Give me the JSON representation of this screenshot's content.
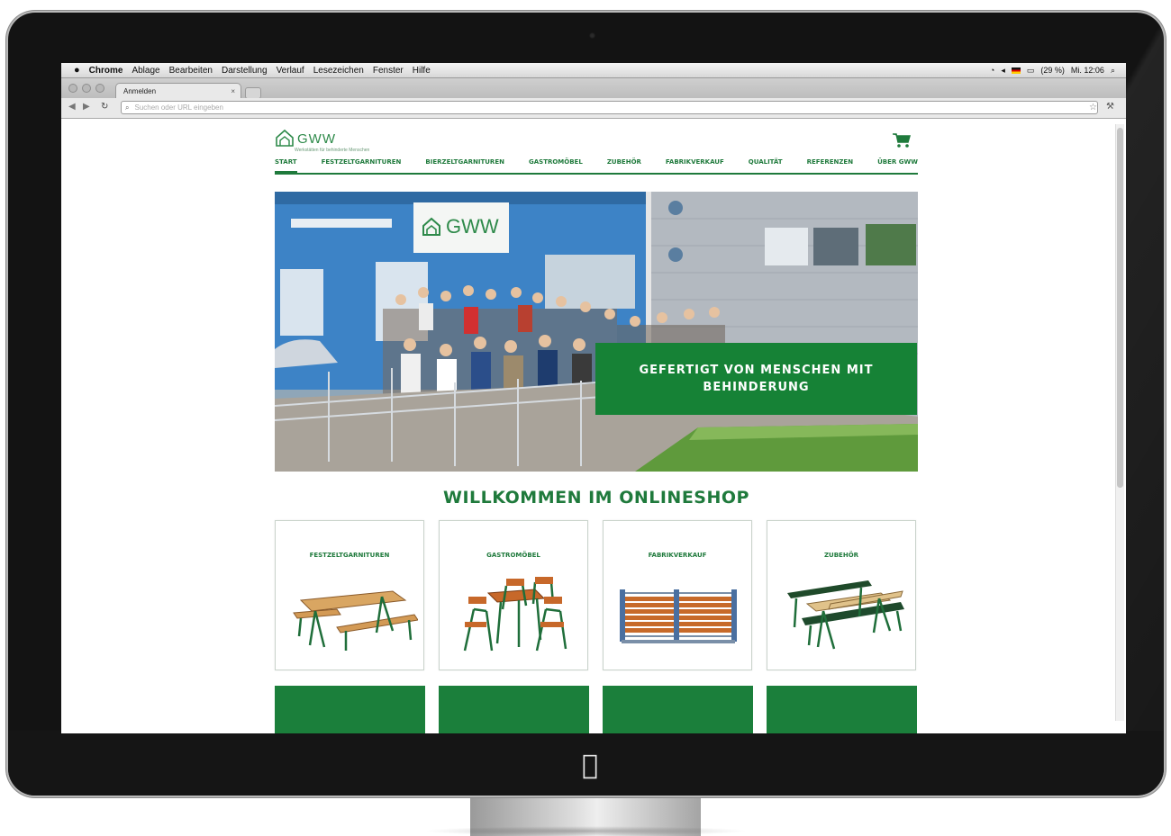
{
  "menubar": {
    "app": "Chrome",
    "items": [
      "Ablage",
      "Bearbeiten",
      "Darstellung",
      "Verlauf",
      "Lesezeichen",
      "Fenster",
      "Hilfe"
    ],
    "status_battery": "(29 %)",
    "status_clock": "Mi. 12:06"
  },
  "browser": {
    "tab_title": "Anmelden",
    "url_placeholder": "Suchen oder URL eingeben"
  },
  "site": {
    "logo_name": "GWW",
    "logo_tagline": "Werkstätten für behinderte Menschen",
    "nav": [
      "START",
      "FESTZELTGARNITUREN",
      "BIERZELTGARNITUREN",
      "GASTROMÖBEL",
      "ZUBEHÖR",
      "FABRIKVERKAUF",
      "QUALITÄT",
      "REFERENZEN",
      "ÜBER GWW"
    ],
    "hero_sign": "GWW",
    "hero_banner": "GEFERTIGT VON MENSCHEN MIT BEHINDERUNG",
    "welcome": "WILLKOMMEN IM ONLINESHOP",
    "categories": [
      "FESTZELTGARNITUREN",
      "GASTROMÖBEL",
      "FABRIKVERKAUF",
      "ZUBEHÖR"
    ],
    "colors": {
      "brand_green": "#1f7a3c",
      "banner_green": "#168236"
    }
  },
  "device": {
    "logo": "apple-logo"
  }
}
